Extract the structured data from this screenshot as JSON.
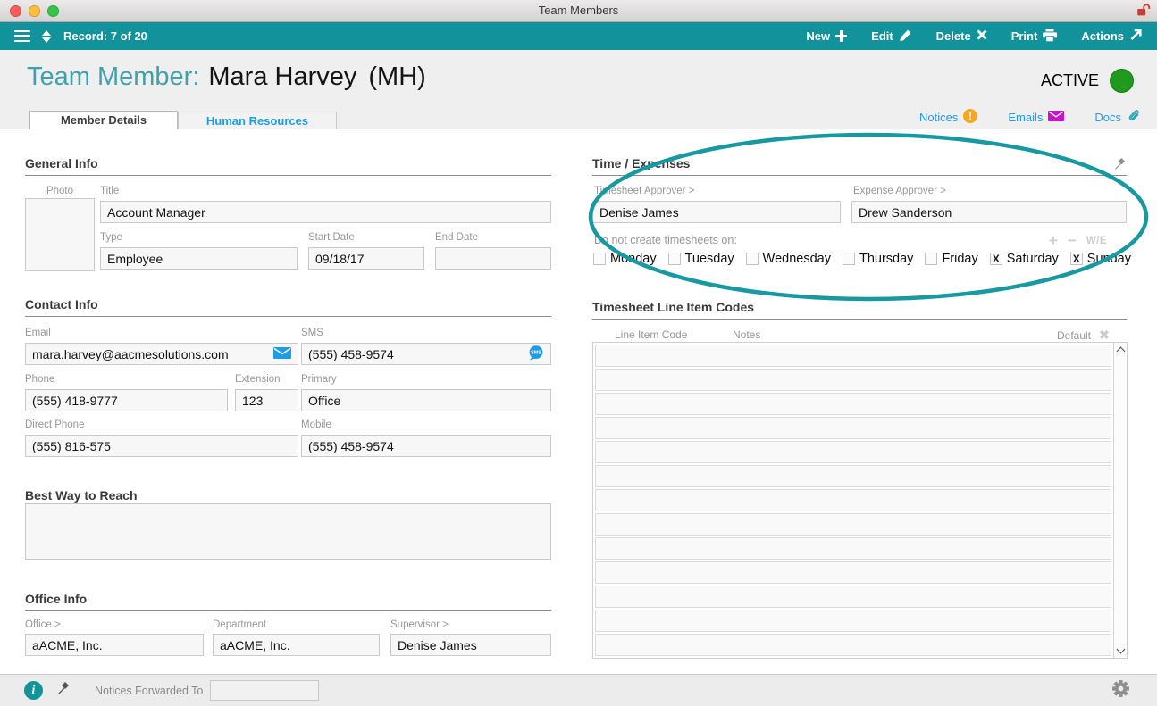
{
  "window": {
    "title": "Team Members"
  },
  "toolbar": {
    "record": "Record: 7 of 20",
    "buttons": [
      {
        "label": "New",
        "icon": "plus-icon"
      },
      {
        "label": "Edit",
        "icon": "pencil-icon"
      },
      {
        "label": "Delete",
        "icon": "x-icon"
      },
      {
        "label": "Print",
        "icon": "printer-icon"
      },
      {
        "label": "Actions",
        "icon": "arrow-up-right-icon"
      }
    ]
  },
  "header": {
    "title_prefix": "Team Member:",
    "name": "Mara Harvey",
    "initials": "(MH)",
    "status": "ACTIVE"
  },
  "tabs": [
    {
      "label": "Member Details",
      "active": true
    },
    {
      "label": "Human Resources",
      "active": false
    }
  ],
  "quick_links": [
    {
      "label": "Notices",
      "icon": "alert-badge-icon"
    },
    {
      "label": "Emails",
      "icon": "envelope-icon"
    },
    {
      "label": "Docs",
      "icon": "paperclip-icon"
    }
  ],
  "sections": {
    "general": {
      "title": "General Info",
      "photo_label": "Photo",
      "fields": {
        "title": {
          "label": "Title",
          "value": "Account Manager"
        },
        "type": {
          "label": "Type",
          "value": "Employee"
        },
        "start": {
          "label": "Start Date",
          "value": "09/18/17"
        },
        "end": {
          "label": "End Date",
          "value": ""
        }
      }
    },
    "contact": {
      "title": "Contact Info",
      "fields": {
        "email": {
          "label": "Email",
          "value": "mara.harvey@aacmesolutions.com"
        },
        "sms": {
          "label": "SMS",
          "value": "(555) 458-9574"
        },
        "phone": {
          "label": "Phone",
          "value": "(555) 418-9777"
        },
        "extension": {
          "label": "Extension",
          "value": "123"
        },
        "primary": {
          "label": "Primary",
          "value": "Office"
        },
        "direct": {
          "label": "Direct Phone",
          "value": "(555) 816-575"
        },
        "mobile": {
          "label": "Mobile",
          "value": "(555) 458-9574"
        }
      }
    },
    "best": {
      "title": "Best Way to Reach",
      "value": ""
    },
    "office": {
      "title": "Office Info",
      "fields": {
        "office": {
          "label": "Office >",
          "value": "aACME, Inc."
        },
        "department": {
          "label": "Department",
          "value": "aACME, Inc."
        },
        "supervisor": {
          "label": "Supervisor >",
          "value": "Denise James"
        }
      }
    },
    "time": {
      "title": "Time / Expenses",
      "fields": {
        "timesheet": {
          "label": "Timesheet Approver >",
          "value": "Denise James"
        },
        "expense": {
          "label": "Expense Approver >",
          "value": "Drew Sanderson"
        }
      },
      "days_label": "Do not create timesheets on:",
      "tools": {
        "plus": "+",
        "minus": "−",
        "we": "W/E"
      },
      "days": [
        {
          "label": "Monday",
          "mark": "",
          "checked": false
        },
        {
          "label": "Tuesday",
          "mark": "",
          "checked": false
        },
        {
          "label": "Wednesday",
          "mark": "",
          "checked": false
        },
        {
          "label": "Thursday",
          "mark": "",
          "checked": false
        },
        {
          "label": "Friday",
          "mark": "",
          "checked": false
        },
        {
          "label": "Saturday",
          "mark": "X",
          "checked": true
        },
        {
          "label": "Sunday",
          "mark": "X",
          "checked": true
        }
      ]
    },
    "codes": {
      "title": "Timesheet Line Item Codes",
      "columns": [
        "Line Item Code",
        "Notes",
        "Default"
      ],
      "rows": []
    }
  },
  "footer": {
    "forwarded_label": "Notices Forwarded To",
    "forwarded_value": ""
  },
  "icons": {
    "titlebar_lock": "unlock-icon",
    "menu": "hamburger-icon",
    "record_nav": "sort-arrows-icon",
    "time_section_pin": "pushpin-icon",
    "footer_info": "info-circle-icon",
    "footer_pin": "pushpin-icon",
    "footer_gear": "gear-icon",
    "email_field": "envelope-icon",
    "sms_field": "sms-bubble-icon",
    "default_clear": "x-icon"
  },
  "colors": {
    "toolbar_teal": "#12929b",
    "header_teal": "#3fa2aa",
    "link_blue": "#1f9ce9",
    "active_green": "#1f9a1f",
    "annotation_teal": "#1898a0",
    "notice_orange": "#f5a723",
    "email_magenta": "#cc10cc",
    "sms_blue": "#1e9be9",
    "unlock_red": "#cf3a2f"
  }
}
